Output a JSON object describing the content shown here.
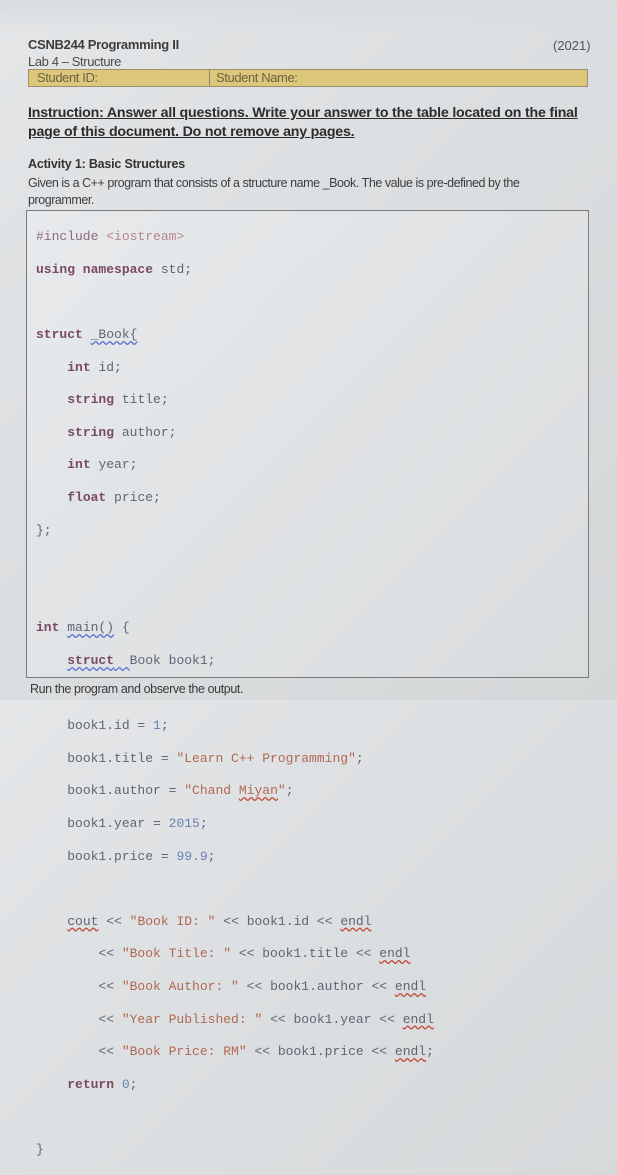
{
  "header": {
    "course_title": "CSNB244 Programming II",
    "lab_title": "Lab 4 – Structure",
    "year": "(2021)",
    "student_id_label": "Student ID:",
    "student_name_label": "Student Name:",
    "bar_color": "#dcc77a"
  },
  "instruction": "Instruction: Answer all questions. Write your answer to the table located on the final page of this document. Do not remove any pages.",
  "activity": {
    "title": "Activity 1: Basic Structures",
    "description": "Given is a C++ program that consists of a structure name _Book. The value is pre-defined by the programmer."
  },
  "code": {
    "include_directive": "#include",
    "include_header": "<iostream>",
    "using_kw": "using namespace",
    "using_ns": "std;",
    "struct_kw": "struct",
    "struct_name": "_Book{",
    "fields": [
      {
        "type": "int",
        "name": "id;"
      },
      {
        "type": "string",
        "name": "title;"
      },
      {
        "type": "string",
        "name": "author;"
      },
      {
        "type": "int",
        "name": "year;"
      },
      {
        "type": "float",
        "name": "price;"
      }
    ],
    "struct_close": "};",
    "main_kw": "int",
    "main_name": "main()",
    "main_open": "{",
    "decl_kw": "struct",
    "decl_rest": "Book book1;",
    "assignments": [
      {
        "lhs": "book1.id = ",
        "value": "1",
        "value_type": "num",
        "end": ";"
      },
      {
        "lhs": "book1.title = ",
        "value": "\"Learn C++ Programming\"",
        "value_type": "str",
        "end": ";"
      },
      {
        "lhs": "book1.author = ",
        "value_pre": "\"Chand ",
        "value_sq": "Miyan",
        "value_post": "\"",
        "value_type": "str",
        "end": ";"
      },
      {
        "lhs": "book1.year = ",
        "value": "2015",
        "value_type": "num",
        "end": ";"
      },
      {
        "lhs": "book1.price = ",
        "value": "99.9",
        "value_type": "num",
        "end": ";"
      }
    ],
    "cout_lines": [
      {
        "lead": "cout",
        "op": " << ",
        "str": "\"Book ID: \"",
        "mid": " << book1.id << ",
        "endl": "endl",
        "end": ""
      },
      {
        "lead": "",
        "op": "<< ",
        "str": "\"Book Title: \"",
        "mid": " << book1.title << ",
        "endl": "endl",
        "end": ""
      },
      {
        "lead": "",
        "op": "<< ",
        "str": "\"Book Author: \"",
        "mid": " << book1.author << ",
        "endl": "endl",
        "end": ""
      },
      {
        "lead": "",
        "op": "<< ",
        "str": "\"Year Published: \"",
        "mid": " << book1.year << ",
        "endl": "endl",
        "end": ""
      },
      {
        "lead": "",
        "op": "<< ",
        "str": "\"Book Price: RM\"",
        "mid": " << book1.price << ",
        "endl": "endl",
        "end": ";"
      }
    ],
    "return_kw": "return",
    "return_val": "0",
    "return_end": ";",
    "main_close": "}"
  },
  "footer_note": "Run the program and observe the output."
}
